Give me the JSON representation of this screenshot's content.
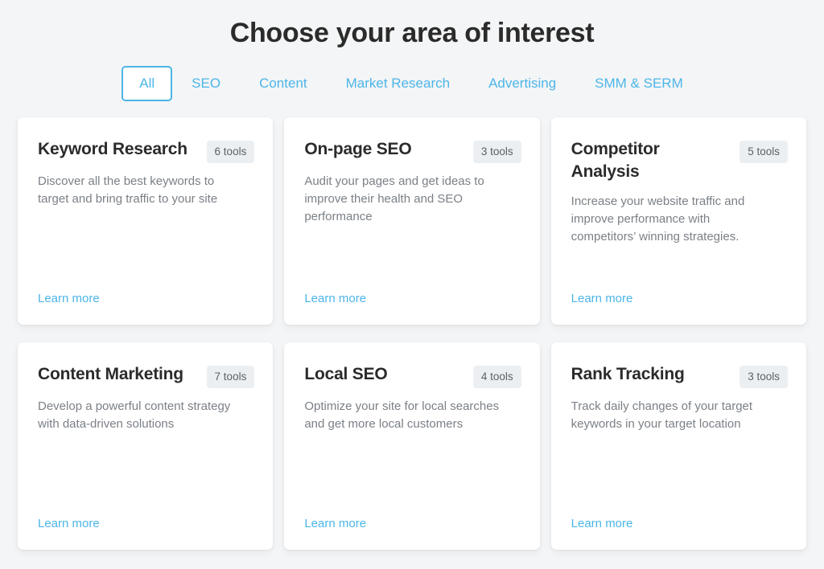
{
  "header": {
    "title": "Choose your area of interest"
  },
  "filters": {
    "active": "All",
    "tabs": [
      {
        "label": "All",
        "active": true
      },
      {
        "label": "SEO",
        "active": false
      },
      {
        "label": "Content",
        "active": false
      },
      {
        "label": "Market Research",
        "active": false
      },
      {
        "label": "Advertising",
        "active": false
      },
      {
        "label": "SMM & SERM",
        "active": false
      }
    ]
  },
  "cards": [
    {
      "title": "Keyword Research",
      "badge": "6 tools",
      "description": "Discover all the best keywords to target and bring traffic to your site",
      "link": "Learn more"
    },
    {
      "title": "On-page SEO",
      "badge": "3 tools",
      "description": "Audit your pages and get ideas to improve their health and SEO performance",
      "link": "Learn more"
    },
    {
      "title": "Competitor Analysis",
      "badge": "5 tools",
      "description": "Increase your website traffic and improve performance with competitors’ winning strategies.",
      "link": "Learn more"
    },
    {
      "title": "Content Marketing",
      "badge": "7 tools",
      "description": "Develop a powerful content strategy with data-driven solutions",
      "link": "Learn more"
    },
    {
      "title": "Local SEO",
      "badge": "4 tools",
      "description": "Optimize your site for local searches and get more local customers",
      "link": "Learn more"
    },
    {
      "title": "Rank Tracking",
      "badge": "3 tools",
      "description": "Track daily changes of your target keywords in your target location",
      "link": "Learn more"
    }
  ],
  "colors": {
    "accent": "#4cb5e8",
    "page_background": "#f4f5f6",
    "card_background": "#ffffff",
    "badge_background": "#eceff2",
    "title_text": "#2b2b2b",
    "body_text": "#7b8086"
  }
}
